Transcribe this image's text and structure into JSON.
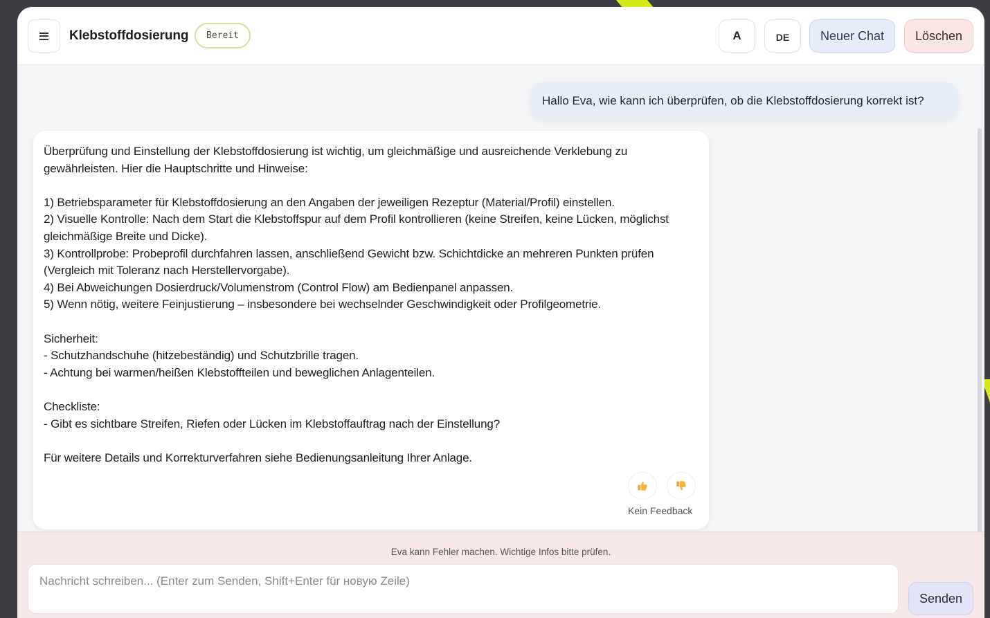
{
  "header": {
    "title": "Klebstoffdosierung",
    "status": "Bereit",
    "font_button": "A",
    "lang_button": "DE",
    "new_chat": "Neuer Chat",
    "delete": "Löschen"
  },
  "chat": {
    "user_message": "Hallo Eva, wie kann ich überprüfen, ob die Klebstoffdosierung korrekt ist?",
    "assistant_message": "Überprüfung und Einstellung der Klebstoffdosierung ist wichtig, um gleichmäßige und ausreichende Verklebung zu gewährleisten. Hier die Hauptschritte und Hinweise:\n\n1) Betriebsparameter für Klebstoffdosierung an den Angaben der jeweiligen Rezeptur (Material/Profil) einstellen.\n2) Visuelle Kontrolle: Nach dem Start die Klebstoffspur auf dem Profil kontrollieren (keine Streifen, keine Lücken, möglichst gleichmäßige Breite und Dicke).\n3) Kontrollprobe: Probeprofil durchfahren lassen, anschließend Gewicht bzw. Schichtdicke an mehreren Punkten prüfen (Vergleich mit Toleranz nach Herstellervorgabe).\n4) Bei Abweichungen Dosierdruck/Volumenstrom (Control Flow) am Bedienpanel anpassen.\n5) Wenn nötig, weitere Feinjustierung – insbesondere bei wechselnder Geschwindigkeit oder Profilgeometrie.\n\nSicherheit:\n- Schutzhandschuhe (hitzebeständig) und Schutzbrille tragen.\n- Achtung bei warmen/heißen Klebstoffteilen und beweglichen Anlagenteilen.\n\nCheckliste:\n- Gibt es sichtbare Streifen, Riefen oder Lücken im Klebstoffauftrag nach der Einstellung?\n\nFür weitere Details und Korrekturverfahren siehe Bedienungsanleitung Ihrer Anlage.",
    "thumbs_up_icon": "thumbs-up-icon",
    "thumbs_down_icon": "thumbs-down-icon",
    "feedback_label": "Kein Feedback"
  },
  "footer": {
    "disclaimer": "Eva kann Fehler machen. Wichtige Infos bitte prüfen.",
    "input_placeholder": "Nachricht schreiben... (Enter zum Senden, Shift+Enter für новую Zeile)",
    "send": "Senden"
  },
  "colors": {
    "accent": "#d7e81a",
    "status_border": "#cfe29e",
    "user_bubble": "#e7eefa",
    "delete_button": "#fbe6e6",
    "footer_bg": "#f7e9ea"
  }
}
